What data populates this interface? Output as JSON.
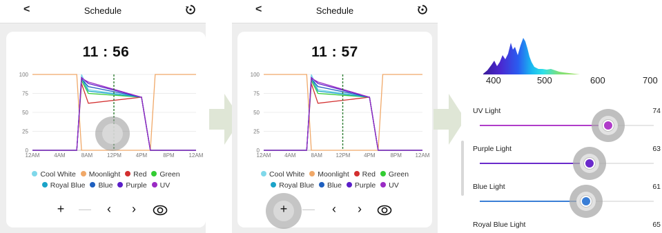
{
  "colors": {
    "cool_white": "#7fd8ea",
    "moonlight": "#f0a868",
    "red": "#d32f2f",
    "green": "#33cc33",
    "royal_blue": "#1aa3c8",
    "blue": "#1e5fbf",
    "purple": "#5a1ec8",
    "uv": "#9a2bc4",
    "uv_slider": "#b03cc9",
    "purple_slider": "#6a2acb",
    "blue_slider": "#3a7ed6",
    "arrow": "#dfe6d6",
    "current_time_line": "#2e7d32"
  },
  "icons": {
    "back": "chevron-left-icon",
    "reset": "reset-clock-icon",
    "add": "plus-icon",
    "remove": "minus-icon",
    "prev": "chevron-left-icon",
    "next": "chevron-right-icon",
    "preview": "eye-icon"
  },
  "screen1": {
    "header": {
      "back": "<",
      "title": "Schedule"
    },
    "time": "11 : 56",
    "toolbar": {
      "add": "+",
      "remove": "—",
      "prev": "‹",
      "next": "›"
    }
  },
  "screen2": {
    "header": {
      "back": "<",
      "title": "Schedule"
    },
    "time": "11 : 57",
    "toolbar": {
      "add": "+",
      "remove": "—",
      "prev": "‹",
      "next": "›"
    }
  },
  "legend": [
    {
      "label": "Cool White",
      "color": "#7fd8ea"
    },
    {
      "label": "Moonlight",
      "color": "#f0a868"
    },
    {
      "label": "Red",
      "color": "#d32f2f"
    },
    {
      "label": "Green",
      "color": "#33cc33"
    },
    {
      "label": "Royal Blue",
      "color": "#1aa3c8"
    },
    {
      "label": "Blue",
      "color": "#1e5fbf"
    },
    {
      "label": "Purple",
      "color": "#5a1ec8"
    },
    {
      "label": "UV",
      "color": "#9a2bc4"
    }
  ],
  "chart_data": {
    "type": "line",
    "x_ticks": [
      "12AM",
      "4AM",
      "8AM",
      "12PM",
      "4PM",
      "8PM",
      "12AM"
    ],
    "y_ticks": [
      "0",
      "25",
      "50",
      "75",
      "100"
    ],
    "ylim": [
      0,
      100
    ],
    "xlim_hours": [
      0,
      24
    ],
    "current_time_hours": 11.95,
    "series": [
      {
        "name": "Moonlight",
        "color": "#f0a868",
        "points": [
          [
            0,
            100
          ],
          [
            6.5,
            100
          ],
          [
            7.2,
            0
          ],
          [
            17.3,
            0
          ],
          [
            18,
            100
          ],
          [
            24,
            100
          ]
        ]
      },
      {
        "name": "Cool White",
        "color": "#7fd8ea",
        "points": [
          [
            0,
            0
          ],
          [
            6.5,
            0
          ],
          [
            7.2,
            100
          ],
          [
            8.2,
            80
          ],
          [
            16,
            70
          ],
          [
            17.3,
            0
          ],
          [
            24,
            0
          ]
        ]
      },
      {
        "name": "Red",
        "color": "#d32f2f",
        "points": [
          [
            0,
            0
          ],
          [
            6.5,
            0
          ],
          [
            7.2,
            88
          ],
          [
            8.2,
            62
          ],
          [
            16,
            70
          ],
          [
            17.3,
            0
          ],
          [
            24,
            0
          ]
        ]
      },
      {
        "name": "Green",
        "color": "#33cc33",
        "points": [
          [
            0,
            0
          ],
          [
            6.5,
            0
          ],
          [
            7.2,
            92
          ],
          [
            8.2,
            75
          ],
          [
            16,
            70
          ],
          [
            17.3,
            0
          ],
          [
            24,
            0
          ]
        ]
      },
      {
        "name": "Royal Blue",
        "color": "#1aa3c8",
        "points": [
          [
            0,
            0
          ],
          [
            6.5,
            0
          ],
          [
            7.2,
            95
          ],
          [
            8.2,
            78
          ],
          [
            16,
            70
          ],
          [
            17.3,
            0
          ],
          [
            24,
            0
          ]
        ]
      },
      {
        "name": "Blue",
        "color": "#1e5fbf",
        "points": [
          [
            0,
            0
          ],
          [
            6.5,
            0
          ],
          [
            7.2,
            94
          ],
          [
            8.2,
            84
          ],
          [
            16,
            70
          ],
          [
            17.3,
            0
          ],
          [
            24,
            0
          ]
        ]
      },
      {
        "name": "Purple",
        "color": "#5a1ec8",
        "points": [
          [
            0,
            0
          ],
          [
            6.5,
            0
          ],
          [
            7.2,
            96
          ],
          [
            8.2,
            88
          ],
          [
            16,
            70
          ],
          [
            17.3,
            0
          ],
          [
            24,
            0
          ]
        ]
      },
      {
        "name": "UV",
        "color": "#9a2bc4",
        "points": [
          [
            0,
            0
          ],
          [
            6.5,
            0
          ],
          [
            7.2,
            95
          ],
          [
            8.2,
            90
          ],
          [
            16,
            70
          ],
          [
            17.3,
            0
          ],
          [
            24,
            0
          ]
        ]
      }
    ]
  },
  "spectrum": {
    "axis": [
      "400",
      "500",
      "600",
      "700"
    ]
  },
  "sliders": [
    {
      "label": "UV Light",
      "value": "74",
      "fraction": 0.74,
      "color": "#b03cc9"
    },
    {
      "label": "Purple Light",
      "value": "63",
      "fraction": 0.63,
      "color": "#6a2acb"
    },
    {
      "label": "Blue Light",
      "value": "61",
      "fraction": 0.61,
      "color": "#3a7ed6"
    },
    {
      "label": "Royal Blue Light",
      "value": "65",
      "fraction": 0.65,
      "color": "#1aa3c8"
    }
  ]
}
